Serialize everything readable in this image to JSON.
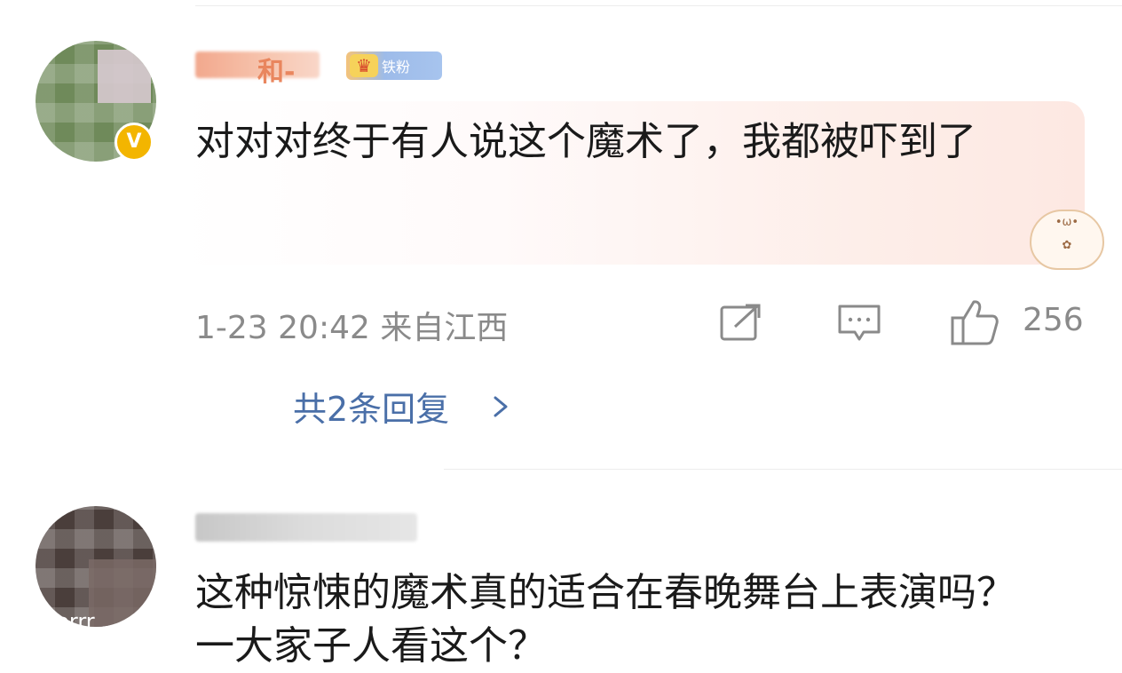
{
  "comments": [
    {
      "badge_text": "铁粉",
      "text": "对对对终于有人说这个魔术了，我都被吓到了",
      "time_location": "1-23 20:42 来自江西",
      "likes": "256",
      "replies_label": "共2条回复",
      "verified_mark": "V"
    },
    {
      "text": "这种惊悚的魔术真的适合在春晚舞台上表演吗？一大家子人看这个？",
      "avatar_text": "corrr"
    }
  ],
  "icons": {
    "share": "share-icon",
    "comment": "comment-icon",
    "like": "thumbs-up-icon",
    "chevron": "chevron-right-icon",
    "crown": "crown-icon"
  },
  "colors": {
    "reply_link": "#4a6fa8",
    "meta_gray": "#8a8a8a",
    "verified": "#f3b500"
  }
}
